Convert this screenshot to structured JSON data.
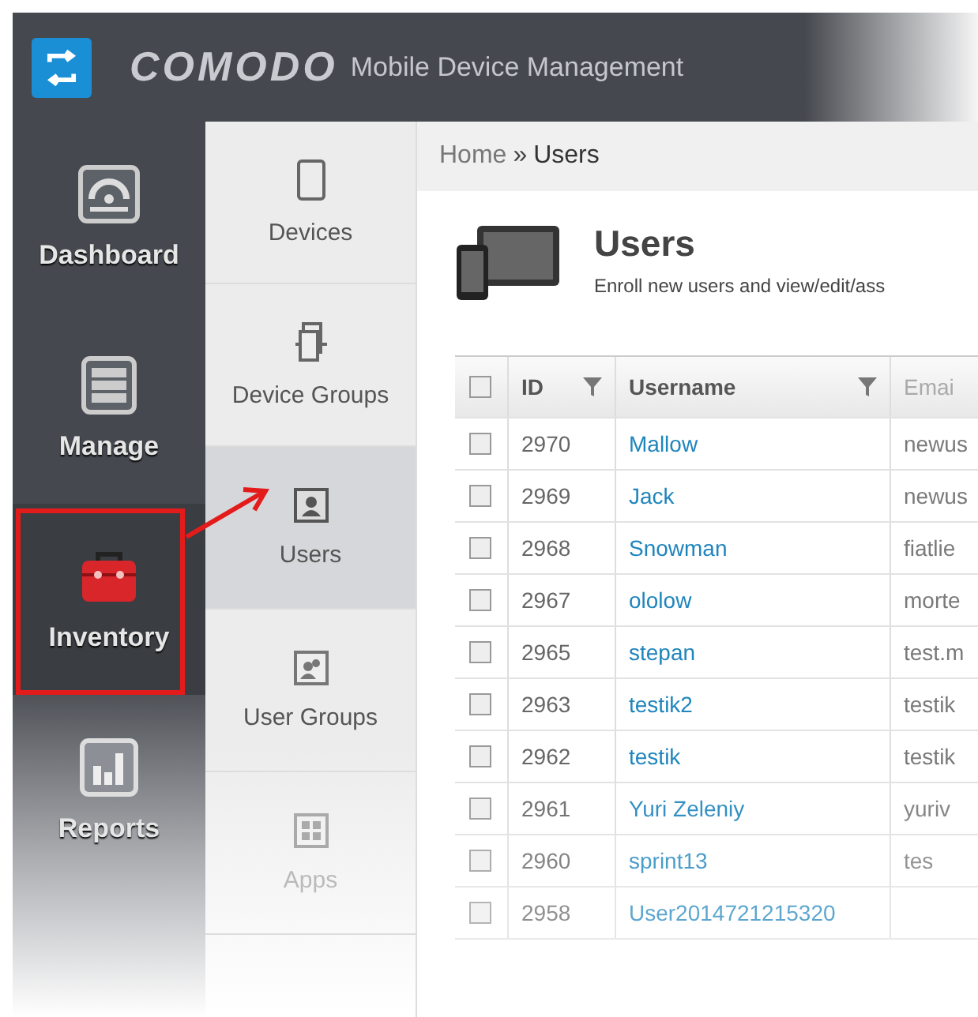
{
  "header": {
    "brand": "COMODO",
    "product": "Mobile Device Management"
  },
  "main_nav": [
    {
      "label": "Dashboard",
      "selected": false
    },
    {
      "label": "Manage",
      "selected": false
    },
    {
      "label": "Inventory",
      "selected": true
    },
    {
      "label": "Reports",
      "selected": false
    }
  ],
  "sub_nav": [
    {
      "label": "Devices",
      "selected": false
    },
    {
      "label": "Device Groups",
      "selected": false
    },
    {
      "label": "Users",
      "selected": true
    },
    {
      "label": "User Groups",
      "selected": false
    },
    {
      "label": "Apps",
      "selected": false
    }
  ],
  "breadcrumb": {
    "home": "Home",
    "separator": "»",
    "current": "Users"
  },
  "page": {
    "title": "Users",
    "subtitle": "Enroll new users and view/edit/ass"
  },
  "table": {
    "columns": [
      {
        "label": "ID",
        "filter": true
      },
      {
        "label": "Username",
        "filter": true
      },
      {
        "label": "Emai",
        "filter": false
      }
    ],
    "all_checked": false,
    "rows": [
      {
        "checked": false,
        "id": "2970",
        "username": "Mallow",
        "email": "newus"
      },
      {
        "checked": false,
        "id": "2969",
        "username": "Jack",
        "email": "newus"
      },
      {
        "checked": false,
        "id": "2968",
        "username": "Snowman",
        "email": "fiatlie"
      },
      {
        "checked": false,
        "id": "2967",
        "username": "ololow",
        "email": "morte"
      },
      {
        "checked": false,
        "id": "2965",
        "username": "stepan",
        "email": "test.m"
      },
      {
        "checked": false,
        "id": "2963",
        "username": "testik2",
        "email": "testik"
      },
      {
        "checked": false,
        "id": "2962",
        "username": "testik",
        "email": "testik"
      },
      {
        "checked": false,
        "id": "2961",
        "username": "Yuri Zeleniy",
        "email": "yuriv"
      },
      {
        "checked": false,
        "id": "2960",
        "username": "sprint13",
        "email": "tes"
      },
      {
        "checked": false,
        "id": "2958",
        "username": "User2014721215320"
      }
    ]
  }
}
